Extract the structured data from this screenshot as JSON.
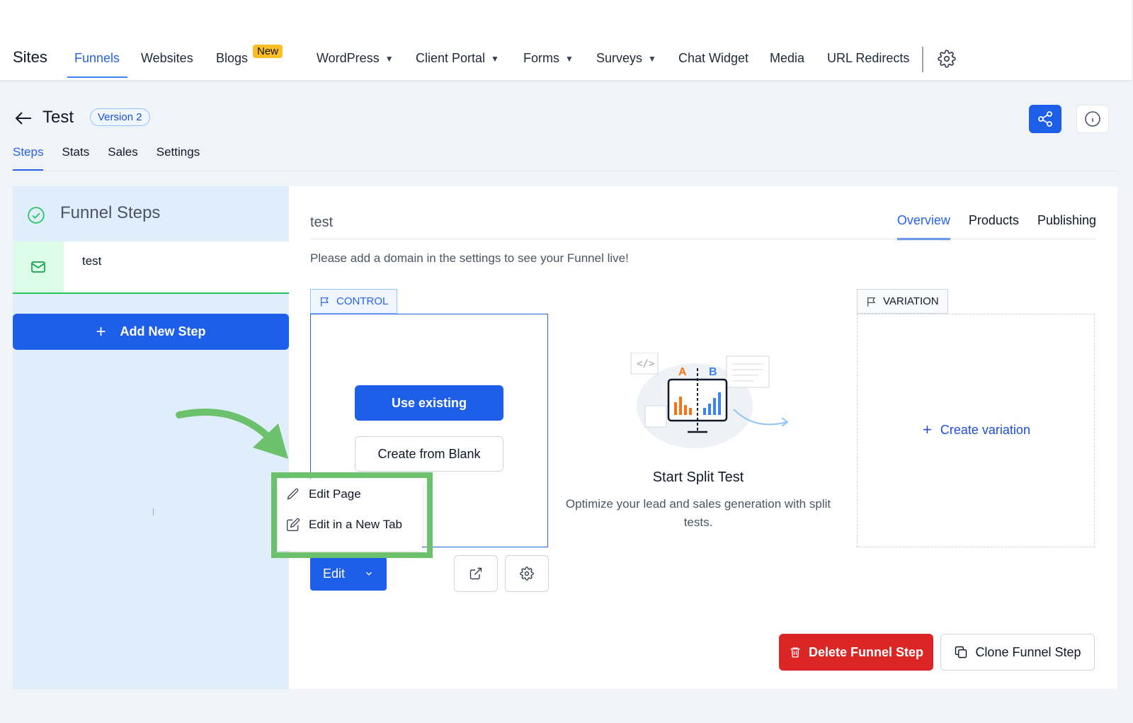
{
  "nav": {
    "brand": "Sites",
    "items": [
      {
        "label": "Funnels",
        "active": true,
        "has_dropdown": false
      },
      {
        "label": "Websites",
        "has_dropdown": false
      },
      {
        "label": "Blogs",
        "has_dropdown": false,
        "badge": "New"
      },
      {
        "label": "WordPress",
        "has_dropdown": true
      },
      {
        "label": "Client Portal",
        "has_dropdown": true
      },
      {
        "label": "Forms",
        "has_dropdown": true
      },
      {
        "label": "Surveys",
        "has_dropdown": true
      },
      {
        "label": "Chat Widget",
        "has_dropdown": false
      },
      {
        "label": "Media",
        "has_dropdown": false
      },
      {
        "label": "URL Redirects",
        "has_dropdown": false
      }
    ],
    "settings_icon": "gear-icon"
  },
  "header": {
    "title": "Test",
    "version_badge": "Version 2",
    "share_icon": "share-icon",
    "info_icon": "info-icon",
    "accent_color": "#1d5fe8"
  },
  "subtabs": [
    {
      "label": "Steps",
      "active": true
    },
    {
      "label": "Stats"
    },
    {
      "label": "Sales"
    },
    {
      "label": "Settings"
    }
  ],
  "sidebar": {
    "title": "Funnel Steps",
    "steps": [
      {
        "name": "test",
        "icon": "mail-icon"
      }
    ],
    "add_step_label": "Add New Step"
  },
  "main": {
    "step_name": "test",
    "tabs": [
      {
        "label": "Overview",
        "active": true
      },
      {
        "label": "Products"
      },
      {
        "label": "Publishing"
      }
    ],
    "domain_note": "Please add a domain in the settings to see your Funnel live!",
    "control": {
      "tag": "CONTROL",
      "use_existing_label": "Use existing",
      "create_blank_label": "Create from Blank"
    },
    "edit_button_label": "Edit",
    "edit_menu": [
      {
        "label": "Edit Page",
        "icon": "pencil-icon"
      },
      {
        "label": "Edit in a New Tab",
        "icon": "edit-square-icon"
      }
    ],
    "split_test": {
      "illustration_letters": [
        "A",
        "B"
      ],
      "title": "Start Split Test",
      "description": "Optimize your lead and sales generation with split tests."
    },
    "variation": {
      "tag": "VARIATION",
      "create_label": "Create variation"
    },
    "delete_label": "Delete Funnel Step",
    "clone_label": "Clone Funnel Step",
    "danger_color": "#dc2626",
    "highlight_color": "#6cc26c"
  }
}
